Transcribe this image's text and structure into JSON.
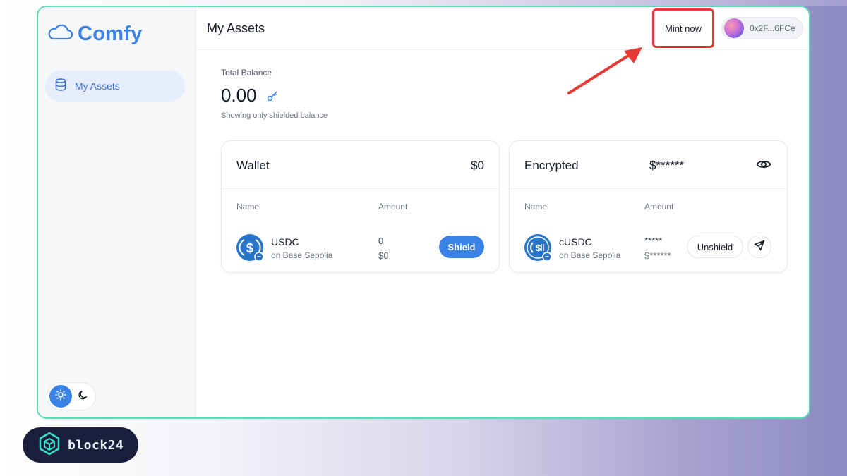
{
  "app": {
    "name": "Comfy"
  },
  "sidebar": {
    "items": [
      {
        "label": "My Assets",
        "icon": "database-icon",
        "active": true
      }
    ]
  },
  "theme": {
    "active": "light"
  },
  "header": {
    "title": "My Assets",
    "mint_label": "Mint now",
    "wallet_address": "0x2F...6FCe"
  },
  "balance": {
    "label": "Total Balance",
    "value": "0.00",
    "note": "Showing only shielded balance"
  },
  "wallet_card": {
    "title": "Wallet",
    "total": "$0",
    "columns": {
      "name": "Name",
      "amount": "Amount"
    },
    "token": {
      "symbol": "USDC",
      "network": "on Base Sepolia",
      "amount": "0",
      "amount_usd": "$0",
      "action": "Shield"
    }
  },
  "encrypted_card": {
    "title": "Encrypted",
    "total": "$******",
    "columns": {
      "name": "Name",
      "amount": "Amount"
    },
    "token": {
      "symbol": "cUSDC",
      "network": "on Base Sepolia",
      "amount": "*****",
      "amount_usd": "$******",
      "action": "Unshield"
    }
  },
  "watermark": {
    "brand": "block24"
  },
  "colors": {
    "accent": "#3b82e6",
    "frame": "#5fd8b8",
    "highlight": "#e53935"
  }
}
